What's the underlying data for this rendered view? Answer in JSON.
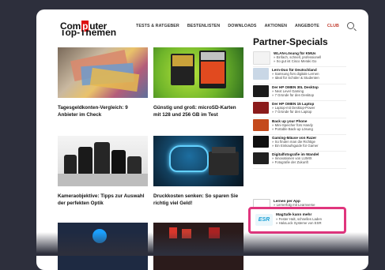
{
  "header": {
    "logo": "Computer",
    "logo_boxed_letter": "p",
    "nav": [
      "TESTS & RATGEBER",
      "BESTENLISTEN",
      "DOWNLOADS",
      "AKTIONEN",
      "ANGEBOTE",
      "CLUB"
    ]
  },
  "top": {
    "title": "Top-Themen",
    "cards": [
      {
        "caption": "Tagesgeldkonten-Vergleich: 9 Anbieter im Check"
      },
      {
        "caption": "Günstig und groß: microSD-Karten mit 128 und 256 GB im Test"
      },
      {
        "caption": "Kameraobjektive: Tipps zur Auswahl der perfekten Optik"
      },
      {
        "caption": "Druckkosten senken: So sparen Sie richtig viel Geld!"
      }
    ]
  },
  "partner": {
    "title": "Partner-Specials",
    "items": [
      {
        "title": "WLAN-Lösung für KMUs",
        "lines": [
          "» Einfach, schnell, professionell",
          "» So gut ist Cisco Meraki Go"
        ]
      },
      {
        "title": "Lern-Duo für Deutschland",
        "lines": [
          "» Samsung fürs digitale Lernen",
          "» Ideal für Schüler & Studenten"
        ]
      },
      {
        "title": "Der HP OMEN 30L Desktop",
        "lines": [
          "» Next Level Gaming",
          "» 7 Gründe für den Desktop"
        ]
      },
      {
        "title": "Der HP OMEN 15 Laptop",
        "lines": [
          "» Laptop-mit Desktop-Power",
          "» 7 Gründe für den Laptop"
        ]
      },
      {
        "title": "Back up your Phone",
        "lines": [
          "» Mini-Speicher fürs Handy",
          "» Portable Back-up Lösung"
        ]
      },
      {
        "title": "Gaming-Mäuse von Razer",
        "lines": [
          "» So finden man die Richtige",
          "» Ein Einkaufsguide für Gamer"
        ]
      },
      {
        "title": "Digitalfotografie im Wandel",
        "lines": [
          "» Innovationen von LUMIX",
          "» Fotografie der Zukunft"
        ]
      },
      {
        "title": "Lernen per App",
        "lines": [
          "» Lernerfolg mit Learnverse",
          "» Digitales Lernen per App"
        ]
      }
    ],
    "highlight": {
      "logo": "ESR",
      "title": "MagSafe kann mehr",
      "lines": [
        "» Fester Halt, schnelles Laden",
        "» HaloLock Systeme von ESR"
      ]
    }
  }
}
